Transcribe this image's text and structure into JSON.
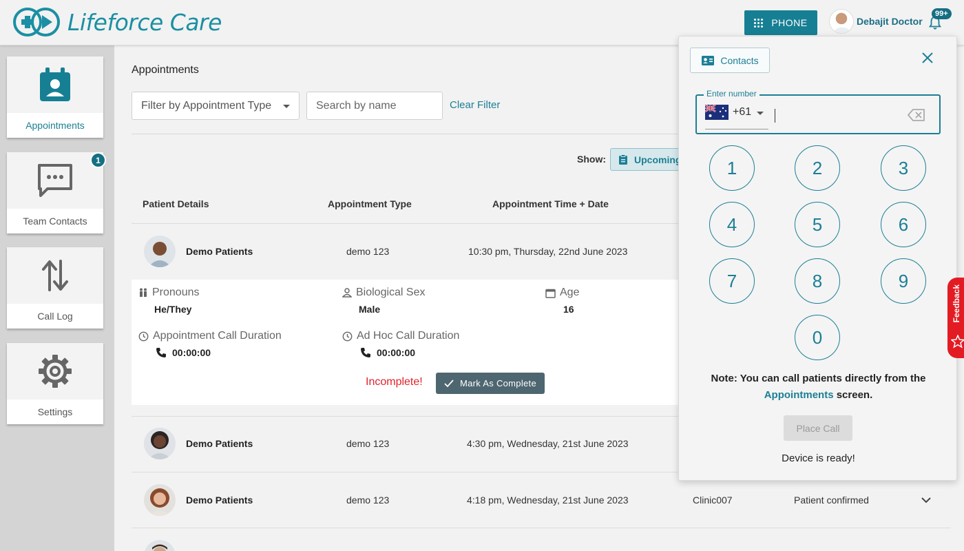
{
  "app": {
    "brand": "Lifeforce Care"
  },
  "header": {
    "phone_label": "PHONE",
    "user_name": "Debajit Doctor",
    "notification_count": "99+"
  },
  "sidebar": {
    "items": [
      {
        "label": "Appointments",
        "icon": "calendar-person-icon"
      },
      {
        "label": "Team Contacts",
        "icon": "chat-icon",
        "badge": "1"
      },
      {
        "label": "Call Log",
        "icon": "swap-arrows-icon"
      },
      {
        "label": "Settings",
        "icon": "gear-icon"
      }
    ]
  },
  "main": {
    "title": "Appointments",
    "filter_placeholder": "Filter by Appointment Type",
    "search_placeholder": "Search by name",
    "clear_filter": "Clear Filter",
    "show_label": "Show:",
    "upcoming_label": "Upcoming",
    "columns": [
      "Patient Details",
      "Appointment Type",
      "Appointment Time + Date"
    ],
    "rows": [
      {
        "name": "Demo Patients",
        "type": "demo 123",
        "datetime": "10:30 pm, Thursday, 22nd June 2023"
      },
      {
        "name": "Demo Patients",
        "type": "demo 123",
        "datetime": "4:30 pm, Wednesday, 21st June 2023"
      },
      {
        "name": "Demo Patients",
        "type": "demo 123",
        "datetime": "4:18 pm, Wednesday, 21st June 2023",
        "clinic": "Clinic007",
        "status": "Patient confirmed"
      }
    ],
    "details": {
      "pronouns_label": "Pronouns",
      "pronouns": "He/They",
      "sex_label": "Biological Sex",
      "sex": "Male",
      "age_label": "Age",
      "age": "16",
      "appt_call_label": "Appointment Call Duration",
      "appt_call_value": "00:00:00",
      "adhoc_call_label": "Ad Hoc Call Duration",
      "adhoc_call_value": "00:00:00",
      "status": "Incomplete!",
      "complete_button": "Mark As Complete"
    }
  },
  "dialer": {
    "contacts_label": "Contacts",
    "field_label": "Enter number",
    "dial_code": "+61",
    "keys": [
      "1",
      "2",
      "3",
      "4",
      "5",
      "6",
      "7",
      "8",
      "9",
      "0"
    ],
    "note_prefix": "Note: You can call patients directly from the",
    "note_link": "Appointments",
    "note_suffix": "screen.",
    "place_call": "Place Call",
    "device_status": "Device is ready!"
  },
  "feedback_label": "Feedback",
  "colors": {
    "brand": "#1b7f95",
    "danger": "#e0232b",
    "feedback": "#e31b23"
  }
}
